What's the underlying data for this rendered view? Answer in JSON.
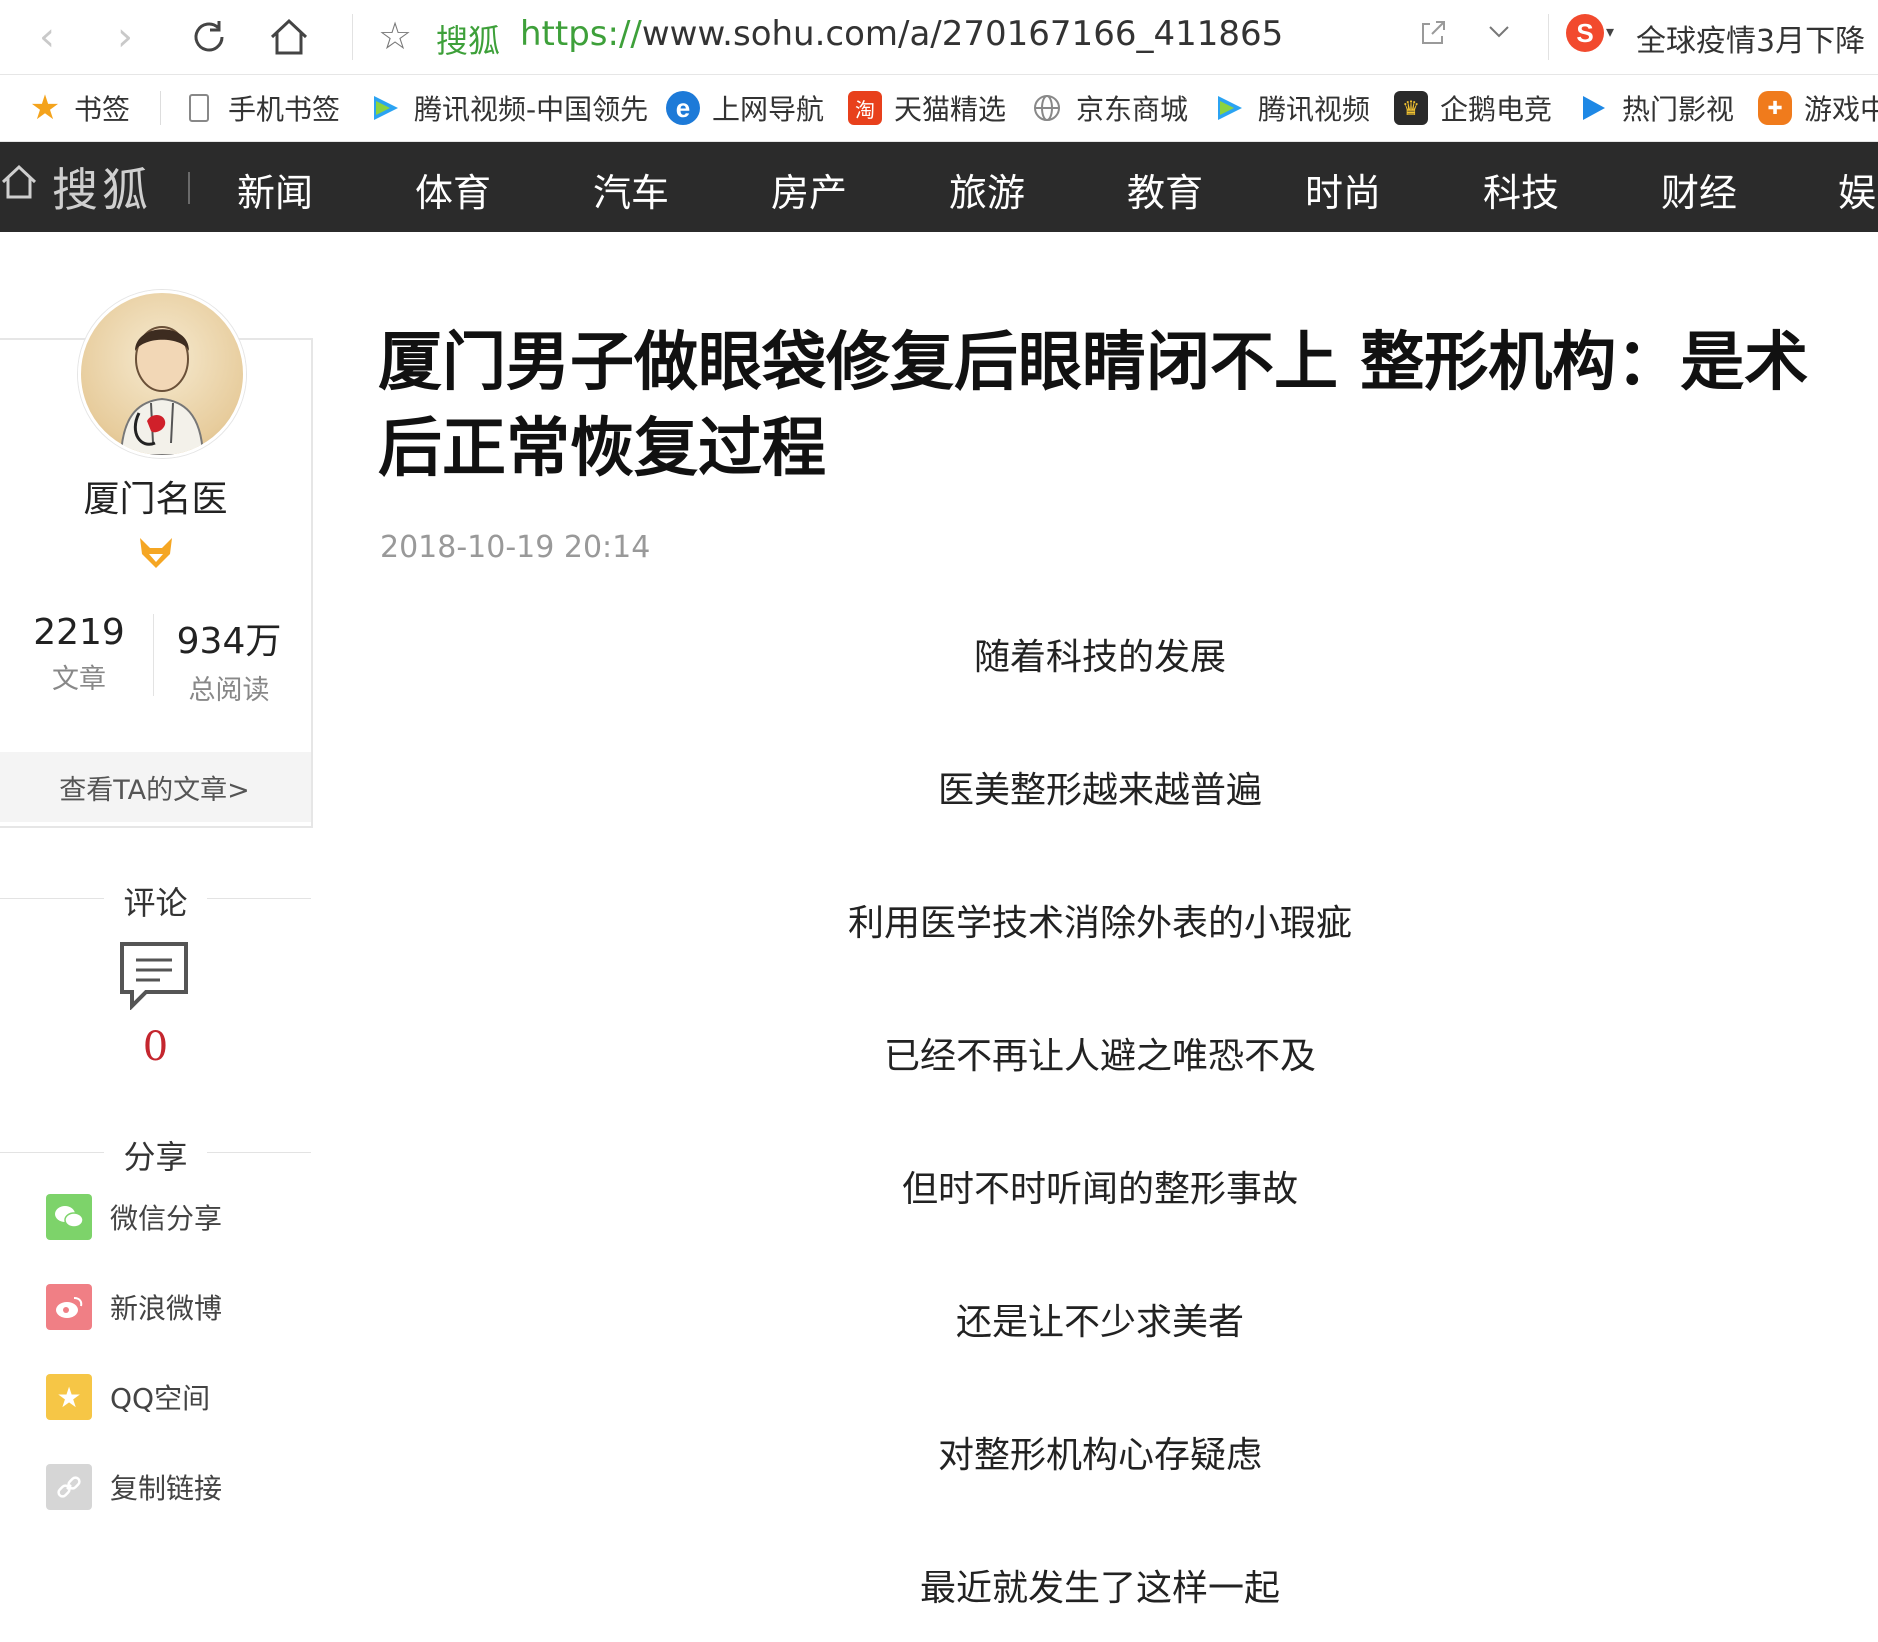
{
  "browser": {
    "site_badge": "搜狐",
    "url_proto": "https://",
    "url_rest": "www.sohu.com/a/270167166_411865",
    "search_engine_letter": "S",
    "hot_search": "全球疫情3月下降"
  },
  "bookmarks": [
    {
      "label": "书签",
      "icon": "star-icon",
      "color": "#f4a31c"
    },
    {
      "label": "手机书签",
      "icon": "phone-icon",
      "color": "#888888"
    },
    {
      "label": "腾讯视频-中国领先",
      "icon": "tencent-video-icon",
      "color": "#2ba3f2"
    },
    {
      "label": "上网导航",
      "icon": "ie-icon",
      "color": "#1d7ad8"
    },
    {
      "label": "天猫精选",
      "icon": "tmall-icon",
      "color": "#e8401c"
    },
    {
      "label": "京东商城",
      "icon": "globe-icon",
      "color": "#888888"
    },
    {
      "label": "腾讯视频",
      "icon": "tencent-video-icon",
      "color": "#2ba3f2"
    },
    {
      "label": "企鹅电竞",
      "icon": "penguin-esports-icon",
      "color": "#2a2a2a"
    },
    {
      "label": "热门影视",
      "icon": "play-icon",
      "color": "#1e88e5"
    },
    {
      "label": "游戏中",
      "icon": "gamepad-icon",
      "color": "#f07b1c"
    }
  ],
  "site_nav": {
    "logo": "搜狐",
    "items": [
      "新闻",
      "体育",
      "汽车",
      "房产",
      "旅游",
      "教育",
      "时尚",
      "科技",
      "财经",
      "娱"
    ]
  },
  "author": {
    "name": "厦门名医",
    "articles_count": "2219",
    "articles_label": "文章",
    "reads_count": "934万",
    "reads_label": "总阅读",
    "view_link": "查看TA的文章>"
  },
  "comments": {
    "heading": "评论",
    "count": "0"
  },
  "share": {
    "heading": "分享",
    "items": [
      {
        "label": "微信分享",
        "icon": "wechat-icon",
        "color": "#7dd36a"
      },
      {
        "label": "新浪微博",
        "icon": "weibo-icon",
        "color": "#f07f85"
      },
      {
        "label": "QQ空间",
        "icon": "qzone-icon",
        "color": "#f6c646"
      },
      {
        "label": "复制链接",
        "icon": "link-icon",
        "color": "#d6d6d6"
      }
    ]
  },
  "article": {
    "title": "厦门男子做眼袋修复后眼睛闭不上 整形机构：是术后正常恢复过程",
    "time": "2018-10-19 20:14",
    "paragraphs": [
      "随着科技的发展",
      "医美整形越来越普遍",
      "利用医学技术消除外表的小瑕疵",
      "已经不再让人避之唯恐不及",
      "但时不时听闻的整形事故",
      "还是让不少求美者",
      "对整形机构心存疑虑",
      "最近就发生了这样一起"
    ]
  }
}
